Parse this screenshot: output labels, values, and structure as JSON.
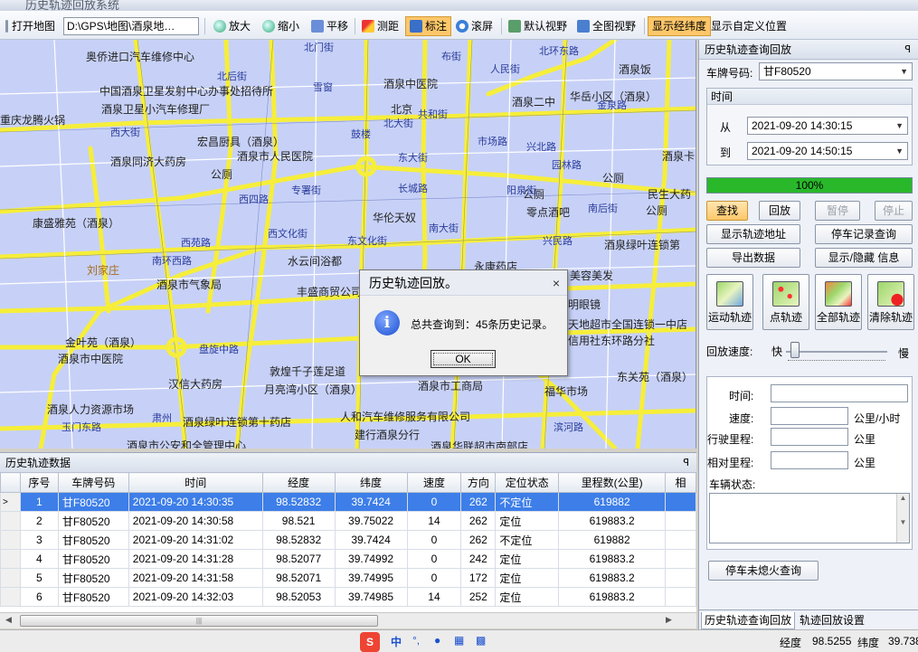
{
  "window": {
    "title": "历史轨迹回放系统"
  },
  "toolbar": {
    "open_map": "打开地图",
    "map_path": "D:\\GPS\\地图\\酒泉地…",
    "zoom_in": "放大",
    "zoom_out": "缩小",
    "pan": "平移",
    "measure": "测距",
    "mark": "标注",
    "scroll": "滚屏",
    "default_view": "默认视野",
    "full_view": "全图视野",
    "show_lnglat": "显示经纬度",
    "show_custom_pos": "显示自定义位置"
  },
  "map": {
    "labels": [
      "奥侨进口汽车维修中心",
      "中国酒泉卫星发射中心办事处招待所",
      "酒泉卫星小汽车修理厂",
      "重庆龙腾火锅",
      "宏昌厨具（酒泉）",
      "酒泉市人民医院",
      "酒泉同济大药房",
      "公厕",
      "康盛雅苑（酒泉）",
      "刘家庄",
      "酒泉市气象局",
      "水云间浴都",
      "丰盛商贸公司",
      "金叶苑（酒泉）",
      "酒泉市中医院",
      "汉信大药房",
      "敦煌千子莲足道",
      "月亮湾小区（酒泉）",
      "酒泉人力资源市场",
      "酒泉绿叶连锁第十药店",
      "人和汽车维修服务有限公司",
      "建行酒泉分行",
      "酒泉华联超市南部店",
      "酒泉市工商局",
      "福华市场",
      "东关苑（酒泉）",
      "明眼镜",
      "天地超市全国连锁一中店",
      "信用社东环路分社",
      "酒泉绿叶连锁第",
      "美容美发",
      "永康药店",
      "华伦天奴",
      "零点酒吧",
      "民生大药",
      "酒泉二中",
      "华岳小区（酒泉）",
      "酒泉中医院",
      "酒泉饭",
      "酒泉卡",
      "公厕",
      "公厕",
      "公厕",
      "北京",
      "酒泉市公安和全管理中心"
    ],
    "roads": [
      "北门街",
      "北环东路",
      "西大街",
      "东大街",
      "东文化街",
      "西文化街",
      "南环西路",
      "盘旋中路",
      "玉门东路",
      "南大街",
      "北大街",
      "共和街",
      "专署街",
      "鼓楼",
      "兴民路",
      "南后街",
      "雪窗",
      "市场路",
      "西苑路",
      "园林路",
      "金泉路",
      "长城路",
      "阳泉街",
      "滨河路",
      "布街",
      "人民街",
      "兴北路",
      "肃州",
      "西四路",
      "北后街"
    ],
    "dialog": {
      "title": "历史轨迹回放。",
      "close": "×",
      "message": "总共查询到：45条历史记录。",
      "ok": "OK"
    }
  },
  "grid": {
    "title": "历史轨迹数据",
    "pin": "ꟼ",
    "columns": [
      "序号",
      "车牌号码",
      "时间",
      "经度",
      "纬度",
      "速度",
      "方向",
      "定位状态",
      "里程数(公里)",
      "相"
    ],
    "rows": [
      {
        "indicator": ">",
        "cells": [
          "1",
          "甘F80520",
          "2021-09-20 14:30:35",
          "98.52832",
          "39.7424",
          "0",
          "262",
          "不定位",
          "619882"
        ]
      },
      {
        "indicator": "",
        "cells": [
          "2",
          "甘F80520",
          "2021-09-20 14:30:58",
          "98.521",
          "39.75022",
          "14",
          "262",
          "定位",
          "619883.2"
        ]
      },
      {
        "indicator": "",
        "cells": [
          "3",
          "甘F80520",
          "2021-09-20 14:31:02",
          "98.52832",
          "39.7424",
          "0",
          "262",
          "不定位",
          "619882"
        ]
      },
      {
        "indicator": "",
        "cells": [
          "4",
          "甘F80520",
          "2021-09-20 14:31:28",
          "98.52077",
          "39.74992",
          "0",
          "242",
          "定位",
          "619883.2"
        ]
      },
      {
        "indicator": "",
        "cells": [
          "5",
          "甘F80520",
          "2021-09-20 14:31:58",
          "98.52071",
          "39.74995",
          "0",
          "172",
          "定位",
          "619883.2"
        ]
      },
      {
        "indicator": "",
        "cells": [
          "6",
          "甘F80520",
          "2021-09-20 14:32:03",
          "98.52053",
          "39.74985",
          "14",
          "252",
          "定位",
          "619883.2"
        ]
      }
    ]
  },
  "right": {
    "title": "历史轨迹查询回放",
    "pin": "ꟼ",
    "plate_label": "车牌号码:",
    "plate_value": "甘F80520",
    "time_group": "时间",
    "from_label": "从",
    "from_value": "2021-09-20 14:30:15",
    "to_label": "到",
    "to_value": "2021-09-20 14:50:15",
    "progress": 1.0,
    "progress_text": "100%",
    "buttons": {
      "find": "查找",
      "replay": "回放",
      "pause": "暂停",
      "stop": "停止",
      "show_addr": "显示轨迹地址",
      "park_query": "停车记录查询",
      "export": "导出数据",
      "toggle_info": "显示/隐藏 信息",
      "dynamic": "运动轨迹",
      "point": "点轨迹",
      "all": "全部轨迹",
      "clear": "清除轨迹",
      "park_noflame": "停车未熄火查询"
    },
    "speed_label": "回放速度:",
    "speed_fast": "快",
    "speed_slow": "慢",
    "speed_level": 0.05,
    "fields": {
      "time": "时间:",
      "speed": "速度:",
      "speed_unit": "公里/小时",
      "mileage": "行驶里程:",
      "mileage_unit": "公里",
      "rel_mileage": "相对里程:",
      "rel_unit": "公里",
      "status": "车辆状态:"
    },
    "tabs": [
      "历史轨迹查询回放",
      "轨迹回放设置"
    ]
  },
  "statusbar": {
    "lng_label": "经度",
    "lng_value": "98.5255",
    "lat_label": "纬度",
    "lat_value": "39.738"
  },
  "ime": {
    "cn": "中",
    "punct": "°,"
  }
}
